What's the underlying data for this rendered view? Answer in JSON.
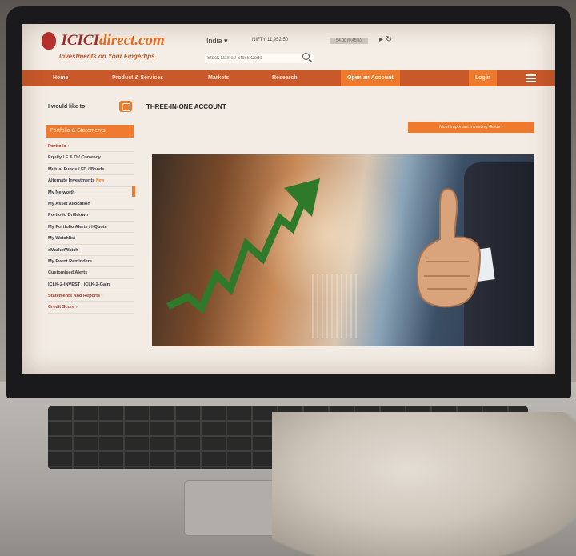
{
  "header": {
    "logo": {
      "brand_main": "ICICI",
      "brand_accent": "direct.com",
      "tagline": "Investments on Your Fingertips"
    },
    "country": "India",
    "index_ticker": "NIFTY 11,952.50",
    "index_value": "54.00 (0.45%)",
    "search": {
      "placeholder": "Stock Name / Stock Code"
    }
  },
  "nav": {
    "items": [
      {
        "label": "Home"
      },
      {
        "label": "Product & Services"
      },
      {
        "label": "Markets"
      },
      {
        "label": "Research"
      },
      {
        "label": "Open an Account",
        "highlight": true
      },
      {
        "label": "Login",
        "highlight": true
      }
    ]
  },
  "sidebar": {
    "want_label": "I would like to",
    "section_label": "Portfolio & Statements",
    "items": [
      {
        "label": "Portfolio",
        "parent": true
      },
      {
        "label": "Equity / F & O / Currency"
      },
      {
        "label": "Mutual Funds / FD / Bonds"
      },
      {
        "label": "Alternate Investments",
        "tag": "New"
      },
      {
        "label": "My Networth"
      },
      {
        "label": "My Asset Allocation"
      },
      {
        "label": "Portfolio Drilldown"
      },
      {
        "label": "My Portfolio Alerts / I-Quote"
      },
      {
        "label": "My Watchlist"
      },
      {
        "label": "eMarketWatch"
      },
      {
        "label": "My Event Reminders"
      },
      {
        "label": "Customised Alerts"
      },
      {
        "label": "ICLK-2-INVEST / iCLK-2-Gain"
      },
      {
        "label": "Statements And Reports",
        "parent": true
      },
      {
        "label": "Credit Score",
        "parent": true
      }
    ]
  },
  "main": {
    "title": "THREE-IN-ONE ACCOUNT",
    "cta_label": "Most Important Investing Guide"
  },
  "colors": {
    "brand_orange": "#ef7a30",
    "nav_bar": "#c9582a",
    "brand_red": "#a52a2a",
    "arrow_green": "#2f7a2a"
  },
  "icons": {
    "search": "search-icon",
    "menu": "hamburger-icon",
    "growth_arrow": "trend-arrow-icon"
  }
}
